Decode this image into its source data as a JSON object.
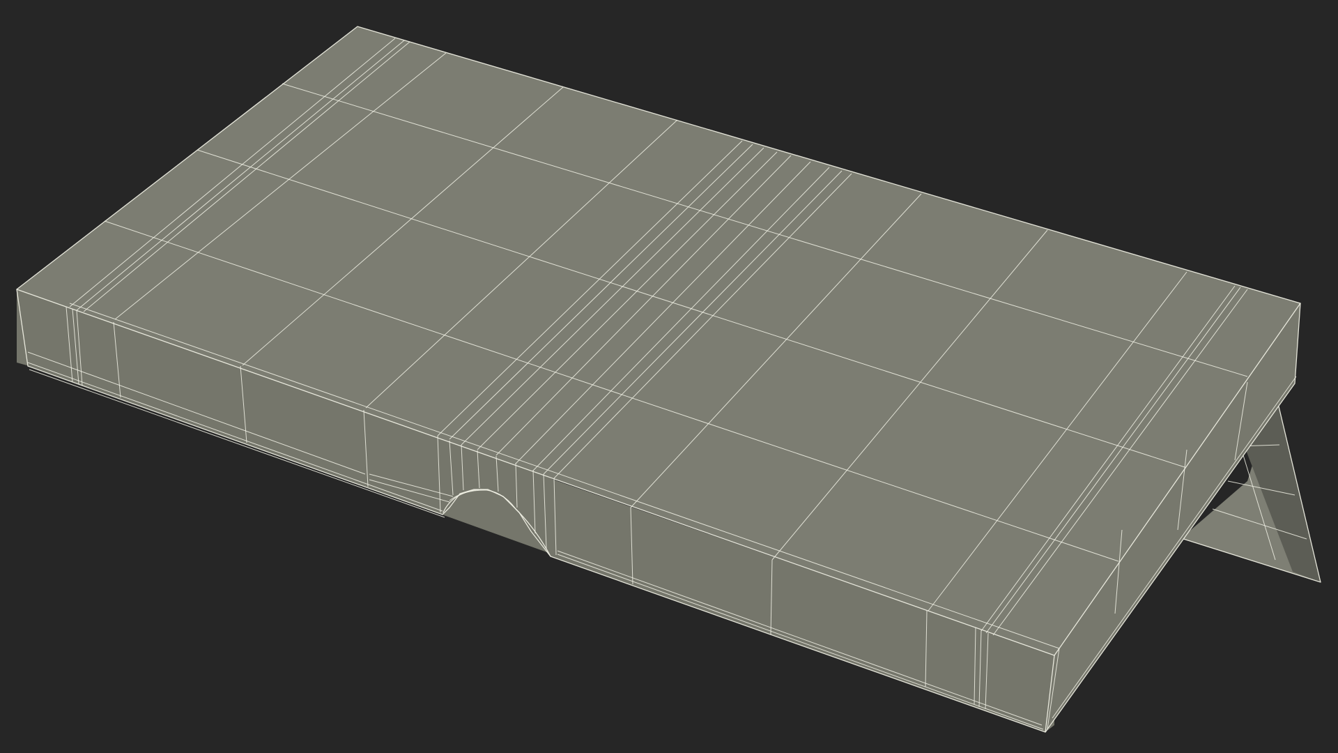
{
  "scene": {
    "subject": "cutting-board-wireframe",
    "colors": {
      "background": "#262626",
      "surface": "#7c7d72",
      "wireframe": "#f2f2e6"
    }
  }
}
